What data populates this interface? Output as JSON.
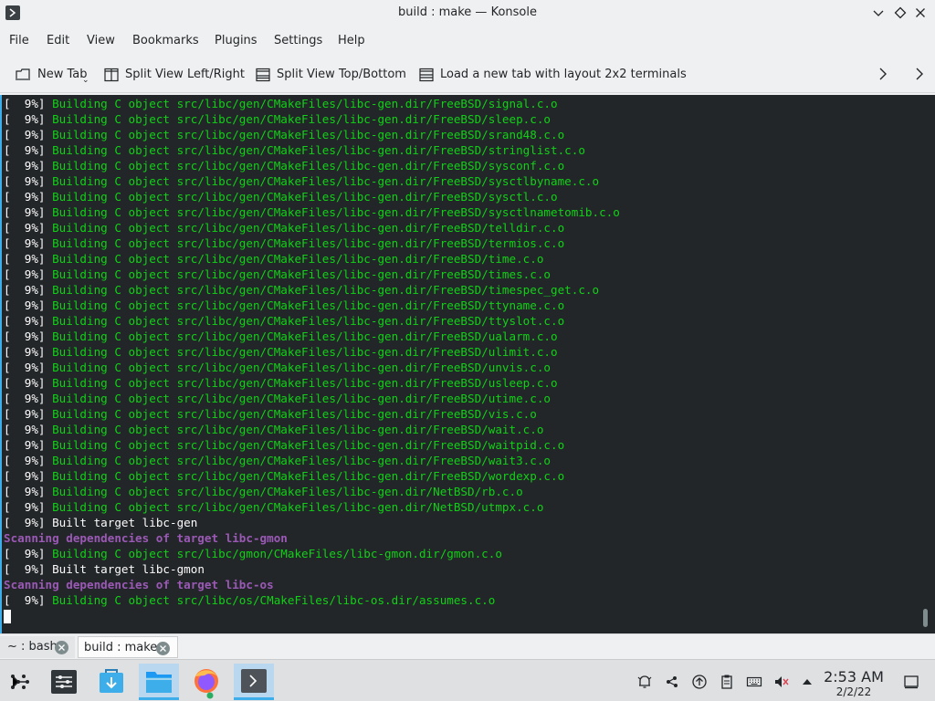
{
  "window": {
    "title": "build : make — Konsole"
  },
  "menubar": [
    "File",
    "Edit",
    "View",
    "Bookmarks",
    "Plugins",
    "Settings",
    "Help"
  ],
  "toolbar": {
    "new_tab": "New Tab",
    "split_lr": "Split View Left/Right",
    "split_tb": "Split View Top/Bottom",
    "layout": "Load a new tab with layout 2x2 terminals"
  },
  "terminal": {
    "lines": [
      {
        "type": "build",
        "pct": "[  9%]",
        "text": "Building C object src/libc/gen/CMakeFiles/libc-gen.dir/FreeBSD/signal.c.o"
      },
      {
        "type": "build",
        "pct": "[  9%]",
        "text": "Building C object src/libc/gen/CMakeFiles/libc-gen.dir/FreeBSD/sleep.c.o"
      },
      {
        "type": "build",
        "pct": "[  9%]",
        "text": "Building C object src/libc/gen/CMakeFiles/libc-gen.dir/FreeBSD/srand48.c.o"
      },
      {
        "type": "build",
        "pct": "[  9%]",
        "text": "Building C object src/libc/gen/CMakeFiles/libc-gen.dir/FreeBSD/stringlist.c.o"
      },
      {
        "type": "build",
        "pct": "[  9%]",
        "text": "Building C object src/libc/gen/CMakeFiles/libc-gen.dir/FreeBSD/sysconf.c.o"
      },
      {
        "type": "build",
        "pct": "[  9%]",
        "text": "Building C object src/libc/gen/CMakeFiles/libc-gen.dir/FreeBSD/sysctlbyname.c.o"
      },
      {
        "type": "build",
        "pct": "[  9%]",
        "text": "Building C object src/libc/gen/CMakeFiles/libc-gen.dir/FreeBSD/sysctl.c.o"
      },
      {
        "type": "build",
        "pct": "[  9%]",
        "text": "Building C object src/libc/gen/CMakeFiles/libc-gen.dir/FreeBSD/sysctlnametomib.c.o"
      },
      {
        "type": "build",
        "pct": "[  9%]",
        "text": "Building C object src/libc/gen/CMakeFiles/libc-gen.dir/FreeBSD/telldir.c.o"
      },
      {
        "type": "build",
        "pct": "[  9%]",
        "text": "Building C object src/libc/gen/CMakeFiles/libc-gen.dir/FreeBSD/termios.c.o"
      },
      {
        "type": "build",
        "pct": "[  9%]",
        "text": "Building C object src/libc/gen/CMakeFiles/libc-gen.dir/FreeBSD/time.c.o"
      },
      {
        "type": "build",
        "pct": "[  9%]",
        "text": "Building C object src/libc/gen/CMakeFiles/libc-gen.dir/FreeBSD/times.c.o"
      },
      {
        "type": "build",
        "pct": "[  9%]",
        "text": "Building C object src/libc/gen/CMakeFiles/libc-gen.dir/FreeBSD/timespec_get.c.o"
      },
      {
        "type": "build",
        "pct": "[  9%]",
        "text": "Building C object src/libc/gen/CMakeFiles/libc-gen.dir/FreeBSD/ttyname.c.o"
      },
      {
        "type": "build",
        "pct": "[  9%]",
        "text": "Building C object src/libc/gen/CMakeFiles/libc-gen.dir/FreeBSD/ttyslot.c.o"
      },
      {
        "type": "build",
        "pct": "[  9%]",
        "text": "Building C object src/libc/gen/CMakeFiles/libc-gen.dir/FreeBSD/ualarm.c.o"
      },
      {
        "type": "build",
        "pct": "[  9%]",
        "text": "Building C object src/libc/gen/CMakeFiles/libc-gen.dir/FreeBSD/ulimit.c.o"
      },
      {
        "type": "build",
        "pct": "[  9%]",
        "text": "Building C object src/libc/gen/CMakeFiles/libc-gen.dir/FreeBSD/unvis.c.o"
      },
      {
        "type": "build",
        "pct": "[  9%]",
        "text": "Building C object src/libc/gen/CMakeFiles/libc-gen.dir/FreeBSD/usleep.c.o"
      },
      {
        "type": "build",
        "pct": "[  9%]",
        "text": "Building C object src/libc/gen/CMakeFiles/libc-gen.dir/FreeBSD/utime.c.o"
      },
      {
        "type": "build",
        "pct": "[  9%]",
        "text": "Building C object src/libc/gen/CMakeFiles/libc-gen.dir/FreeBSD/vis.c.o"
      },
      {
        "type": "build",
        "pct": "[  9%]",
        "text": "Building C object src/libc/gen/CMakeFiles/libc-gen.dir/FreeBSD/wait.c.o"
      },
      {
        "type": "build",
        "pct": "[  9%]",
        "text": "Building C object src/libc/gen/CMakeFiles/libc-gen.dir/FreeBSD/waitpid.c.o"
      },
      {
        "type": "build",
        "pct": "[  9%]",
        "text": "Building C object src/libc/gen/CMakeFiles/libc-gen.dir/FreeBSD/wait3.c.o"
      },
      {
        "type": "build",
        "pct": "[  9%]",
        "text": "Building C object src/libc/gen/CMakeFiles/libc-gen.dir/FreeBSD/wordexp.c.o"
      },
      {
        "type": "build",
        "pct": "[  9%]",
        "text": "Building C object src/libc/gen/CMakeFiles/libc-gen.dir/NetBSD/rb.c.o"
      },
      {
        "type": "build",
        "pct": "[  9%]",
        "text": "Building C object src/libc/gen/CMakeFiles/libc-gen.dir/NetBSD/utmpx.c.o"
      },
      {
        "type": "target",
        "pct": "[  9%]",
        "text": "Built target libc-gen"
      },
      {
        "type": "scan",
        "pct": "",
        "text": "Scanning dependencies of target libc-gmon"
      },
      {
        "type": "build",
        "pct": "[  9%]",
        "text": "Building C object src/libc/gmon/CMakeFiles/libc-gmon.dir/gmon.c.o"
      },
      {
        "type": "target",
        "pct": "[  9%]",
        "text": "Built target libc-gmon"
      },
      {
        "type": "scan",
        "pct": "",
        "text": "Scanning dependencies of target libc-os"
      },
      {
        "type": "build",
        "pct": "[  9%]",
        "text": "Building C object src/libc/os/CMakeFiles/libc-os.dir/assumes.c.o"
      }
    ]
  },
  "tabs": [
    {
      "label": "~ : bash"
    },
    {
      "label": "build : make"
    }
  ],
  "clock": {
    "time": "2:53 AM",
    "date": "2/2/22"
  },
  "colors": {
    "terminal_bg": "#232629",
    "build_text": "#11d116",
    "scan_text": "#9b59b6",
    "accent": "#3daee9"
  }
}
